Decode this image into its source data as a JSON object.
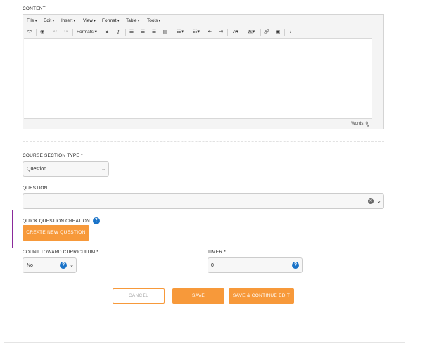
{
  "content_label": "CONTENT",
  "editor": {
    "menus": [
      "File",
      "Edit",
      "Insert",
      "View",
      "Format",
      "Table",
      "Tools"
    ],
    "formats_label": "Formats",
    "word_count_label": "Words: 0"
  },
  "course_section_type": {
    "label": "COURSE SECTION TYPE *",
    "value": "Question"
  },
  "question": {
    "label": "QUESTION",
    "value": ""
  },
  "quick_question": {
    "label": "QUICK QUESTION CREATION",
    "button": "CREATE NEW QUESTION",
    "highlight_color": "#8a2a9b"
  },
  "count_toward": {
    "label": "COUNT TOWARD CURRICULUM *",
    "value": "No"
  },
  "timer": {
    "label": "TIMER *",
    "value": "0"
  },
  "actions": {
    "cancel": "CANCEL",
    "save": "SAVE",
    "save_continue": "SAVE & CONTINUE EDIT"
  },
  "colors": {
    "accent": "#f7993a",
    "help": "#1a73c8"
  }
}
